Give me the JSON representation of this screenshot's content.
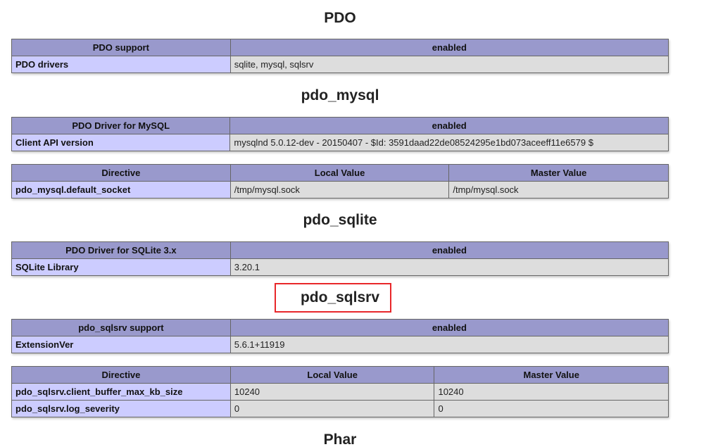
{
  "sections": {
    "pdo": {
      "title": "PDO",
      "header": [
        "PDO support",
        "enabled"
      ],
      "rows": [
        [
          "PDO drivers",
          "sqlite, mysql, sqlsrv"
        ]
      ]
    },
    "pdo_mysql": {
      "title": "pdo_mysql",
      "header": [
        "PDO Driver for MySQL",
        "enabled"
      ],
      "rows": [
        [
          "Client API version",
          "mysqlnd 5.0.12-dev - 20150407 - $Id: 3591daad22de08524295e1bd073aceeff11e6579 $"
        ]
      ],
      "directives": {
        "header": [
          "Directive",
          "Local Value",
          "Master Value"
        ],
        "rows": [
          [
            "pdo_mysql.default_socket",
            "/tmp/mysql.sock",
            "/tmp/mysql.sock"
          ]
        ]
      }
    },
    "pdo_sqlite": {
      "title": "pdo_sqlite",
      "header": [
        "PDO Driver for SQLite 3.x",
        "enabled"
      ],
      "rows": [
        [
          "SQLite Library",
          "3.20.1"
        ]
      ]
    },
    "pdo_sqlsrv": {
      "title": "pdo_sqlsrv",
      "highlight_color": "#e8272a",
      "header": [
        "pdo_sqlsrv support",
        "enabled"
      ],
      "rows": [
        [
          "ExtensionVer",
          "5.6.1+11919"
        ]
      ],
      "directives": {
        "header": [
          "Directive",
          "Local Value",
          "Master Value"
        ],
        "rows": [
          [
            "pdo_sqlsrv.client_buffer_max_kb_size",
            "10240",
            "10240"
          ],
          [
            "pdo_sqlsrv.log_severity",
            "0",
            "0"
          ]
        ]
      }
    },
    "phar": {
      "title": "Phar"
    }
  },
  "colors": {
    "header_bg": "#9999cc",
    "key_bg": "#ccccff",
    "value_bg": "#dddddd"
  }
}
